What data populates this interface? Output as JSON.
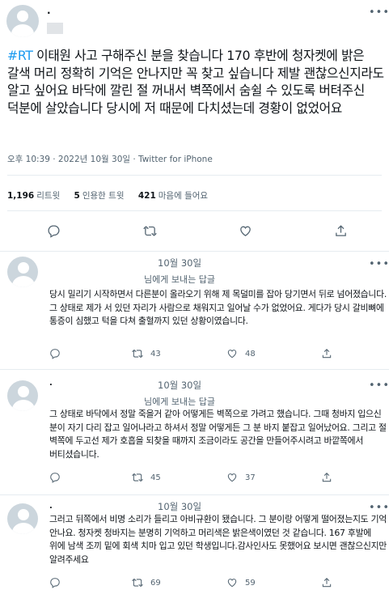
{
  "main_tweet": {
    "author_initial": ".",
    "hashtag": "#RT",
    "text": " 이태원 사고 구해주신 분을 찾습니다 170 후반에 청자켓에 밝은 갈색 머리 정확히 기억은 안나지만 꼭 찾고 싶습니다 제발 괜찮으신지라도 알고 싶어요 바닥에 깔린 절 꺼내서 벽쪽에서 숨쉴 수 있도록 버텨주신 덕분에 살았습니다 당시에 저 때문에 다치셨는데 경황이 없었어요",
    "meta": "오후 10:39 · 2022년 10월 30일 · Twitter for iPhone",
    "stats": {
      "retweets_count": "1,196",
      "retweets_label": "리트윗",
      "quotes_count": "5",
      "quotes_label": "인용한 트윗",
      "likes_count": "421",
      "likes_label": "마음에 들어요"
    }
  },
  "replies": [
    {
      "name": "",
      "date": "10월 30일",
      "replying_to": "님에게 보내는 답글",
      "text": "당시 밀리기 시작하면서 다른분이 올라오기 위해 제 목덜미를 잡아 당기면서 뒤로 넘어졌습니다. 그 상태로 제가 서 있던 자리가 사람으로 채워지고 일어날 수가 없었어요. 게다가 당시 갈비뼈에 통증이 심했고 턱을 다쳐 출혈까지 있던 상황이였습니다.",
      "retweets": "43",
      "likes": "48"
    },
    {
      "name": ".",
      "date": "10월 30일",
      "replying_to": "님에게 보내는 답글",
      "text": "그 상태로 바닥에서 정말 죽을거 같아 어떻게든 벽쪽으로 가려고 했습니다. 그때 청바지 입으신 분이 자기 다리 잡고 일어나라고 하셔서 정말 어떻게든 그 분 바지 붙잡고 일어났어요. 그리고 절 벽쪽에 두고선 제가 호흡을 되찾을 때까지 조금이라도 공간을 만들어주시려고 바깥쪽에서 버티셨습니다.",
      "retweets": "45",
      "likes": "37"
    },
    {
      "name": ".",
      "date": "10월 30일",
      "replying_to": "",
      "text": "그러고 뒤쪽에서 비명 소리가 들리고 아비규환이 됐습니다. 그 분이랑 어떻게 떨어졌는지도 기억 안나요. 청자켓 청바지는 분명히 기억하고 머리색은 밝은색이였던 것 같습니다. 167 후발에 위에 남색 조끼 밑에 회색 치마 입고 있던 학생입니다.감사인사도 못했어요 보시면 괜찮으신지만 알려주세요",
      "retweets": "69",
      "likes": "59"
    }
  ],
  "colors": {
    "accent": "#1d9bf0",
    "muted": "#536471",
    "border": "#e6ecf0"
  }
}
